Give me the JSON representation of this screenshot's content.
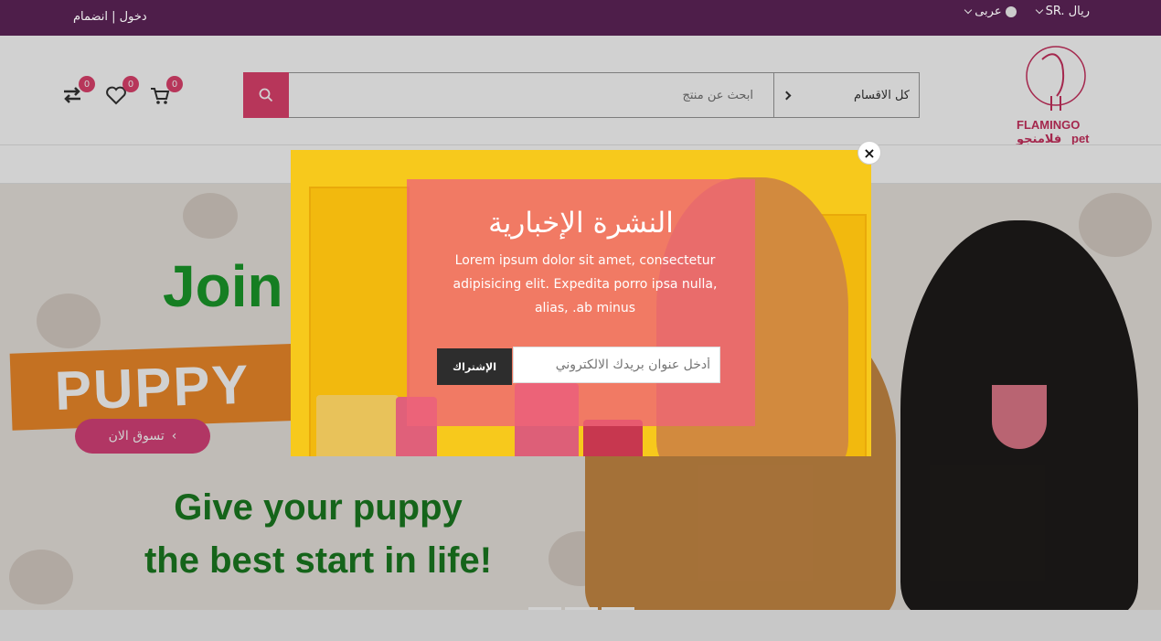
{
  "topbar": {
    "auth_label": "دخول | انضمام",
    "currency_label": "SR. ريال",
    "language_label": "عربى"
  },
  "header": {
    "logo_text_en": "FLAMINGO",
    "logo_text_ar": "فلامنجو",
    "logo_suffix": "pet",
    "search_placeholder": "ابحث عن منتج",
    "category_label": "كل الاقسام",
    "compare_count": "0",
    "wishlist_count": "0",
    "cart_count": "0"
  },
  "hero": {
    "headline": "Join",
    "badge": "PUPPY",
    "shop_button": "تسوق الان",
    "tagline_line1": "Give your puppy",
    "tagline_line2": "the best start in life!"
  },
  "newsletter": {
    "title": "النشرة الإخبارية",
    "body": "Lorem ipsum dolor sit amet, consectetur adipisicing elit. Expedita porro ipsa nulla, alias, .ab minus",
    "email_placeholder": "أدخل عنوان بريدك الالكتروني",
    "subscribe_label": "الإشتراك",
    "close_symbol": "×"
  },
  "colors": {
    "topbar": "#4e1e4a",
    "accent": "#e0426e",
    "modal_bg": "#f7c91c"
  }
}
